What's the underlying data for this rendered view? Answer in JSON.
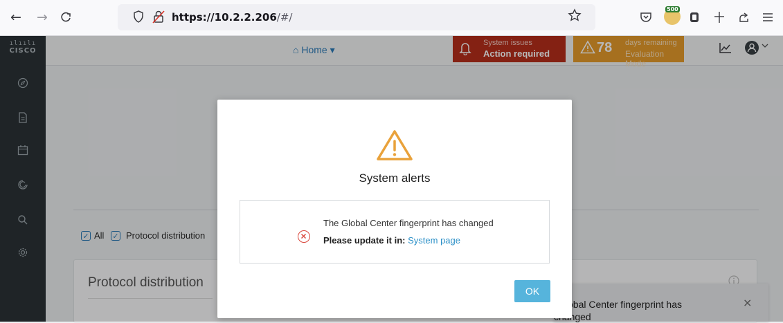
{
  "browser": {
    "url_host": "https://10.2.2.206",
    "url_path": "/#/",
    "back_icon": "←",
    "forward_icon": "→",
    "reload_icon": "C",
    "ext_badge": "500"
  },
  "sidebar": {
    "logo_bars": "ılıılı",
    "logo_word": "CISCO"
  },
  "topnav": {
    "home_label": "⌂ Home ▾",
    "system_issues_line1": "System issues",
    "system_issues_line2": "Action required",
    "days_count": "78",
    "days_line1": "days remaining",
    "days_line2": "Evaluation Mode"
  },
  "background": {
    "filter_all": "All",
    "filter_protocol": "Protocol distribution",
    "panel_title": "Protocol distribution"
  },
  "toast": {
    "line1": "The Global Center fingerprint has",
    "line2": "changed",
    "close": "×"
  },
  "modal": {
    "title": "System alerts",
    "message": "The Global Center fingerprint has changed",
    "action_prefix": "Please update it in:",
    "action_link": "System page",
    "ok_label": "OK"
  },
  "colors": {
    "alert_red": "#b82f1b",
    "alert_orange": "#e79b2b",
    "ok_button": "#56b4dc",
    "link": "#2a8fc7",
    "warning_icon": "#e9a23b",
    "error_icon": "#d9463b"
  }
}
